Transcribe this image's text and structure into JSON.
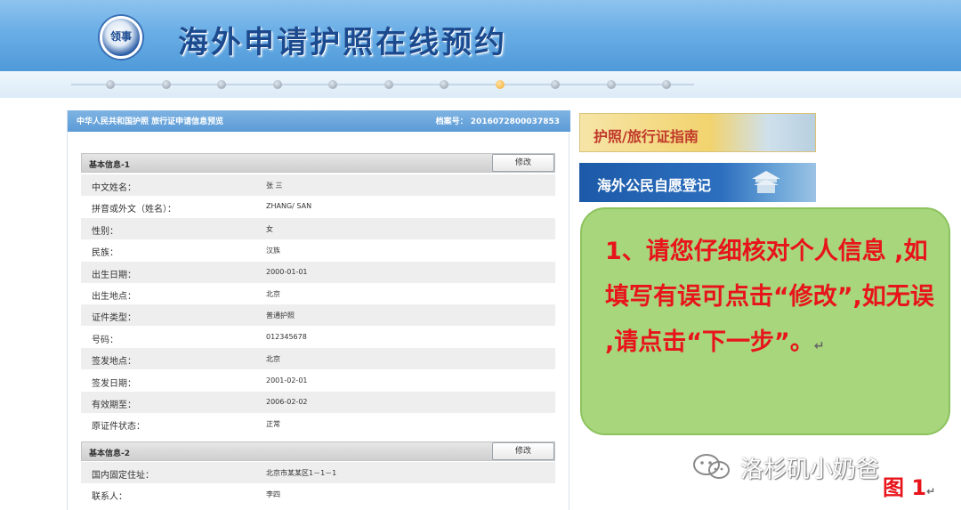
{
  "header": {
    "title": "海外申请护照在线预约",
    "logo_text": "领事"
  },
  "progress": {
    "total_steps": 11,
    "current_step": 8
  },
  "panel": {
    "title": "中华人民共和国护照 旅行证申请信息预览",
    "file_number_label": "档案号：",
    "file_number": "2016072800037853",
    "section1": {
      "label": "基本信息-1",
      "edit_label": "修改",
      "rows": [
        {
          "label": "中文姓名：",
          "value": "张 三"
        },
        {
          "label": "拼音或外文（姓名）：",
          "value": "ZHANG/ SAN"
        },
        {
          "label": "性别：",
          "value": "女"
        },
        {
          "label": "民族：",
          "value": "汉族"
        },
        {
          "label": "出生日期：",
          "value": "2000-01-01"
        },
        {
          "label": "出生地点：",
          "value": "北京"
        },
        {
          "label": "证件类型：",
          "value": "普通护照"
        },
        {
          "label": "号码：",
          "value": "012345678"
        },
        {
          "label": "签发地点：",
          "value": "北京"
        },
        {
          "label": "签发日期：",
          "value": "2001-02-01"
        },
        {
          "label": "有效期至：",
          "value": "2006-02-02"
        },
        {
          "label": "原证件状态：",
          "value": "正常"
        }
      ]
    },
    "section2": {
      "label": "基本信息-2",
      "edit_label": "修改",
      "rows": [
        {
          "label": "国内固定住址：",
          "value": "北京市某某区1－1－1"
        },
        {
          "label": "联系人：",
          "value": "李四"
        }
      ]
    }
  },
  "sidebar": {
    "banner1": "护照/旅行证指南",
    "banner2": "海外公民自愿登记"
  },
  "note": {
    "text": "1、请您仔细核对个人信息 ,如填写有误可点击“修改”,如无误 ,请点击“下一步”。"
  },
  "watermark": {
    "text": "洛杉矶小奶爸"
  },
  "figure_label": "图 1",
  "colors": {
    "header_blue": "#5b9ad6",
    "note_green": "#a8d67c",
    "note_red": "#e8141b",
    "active_step": "#f5a623"
  }
}
